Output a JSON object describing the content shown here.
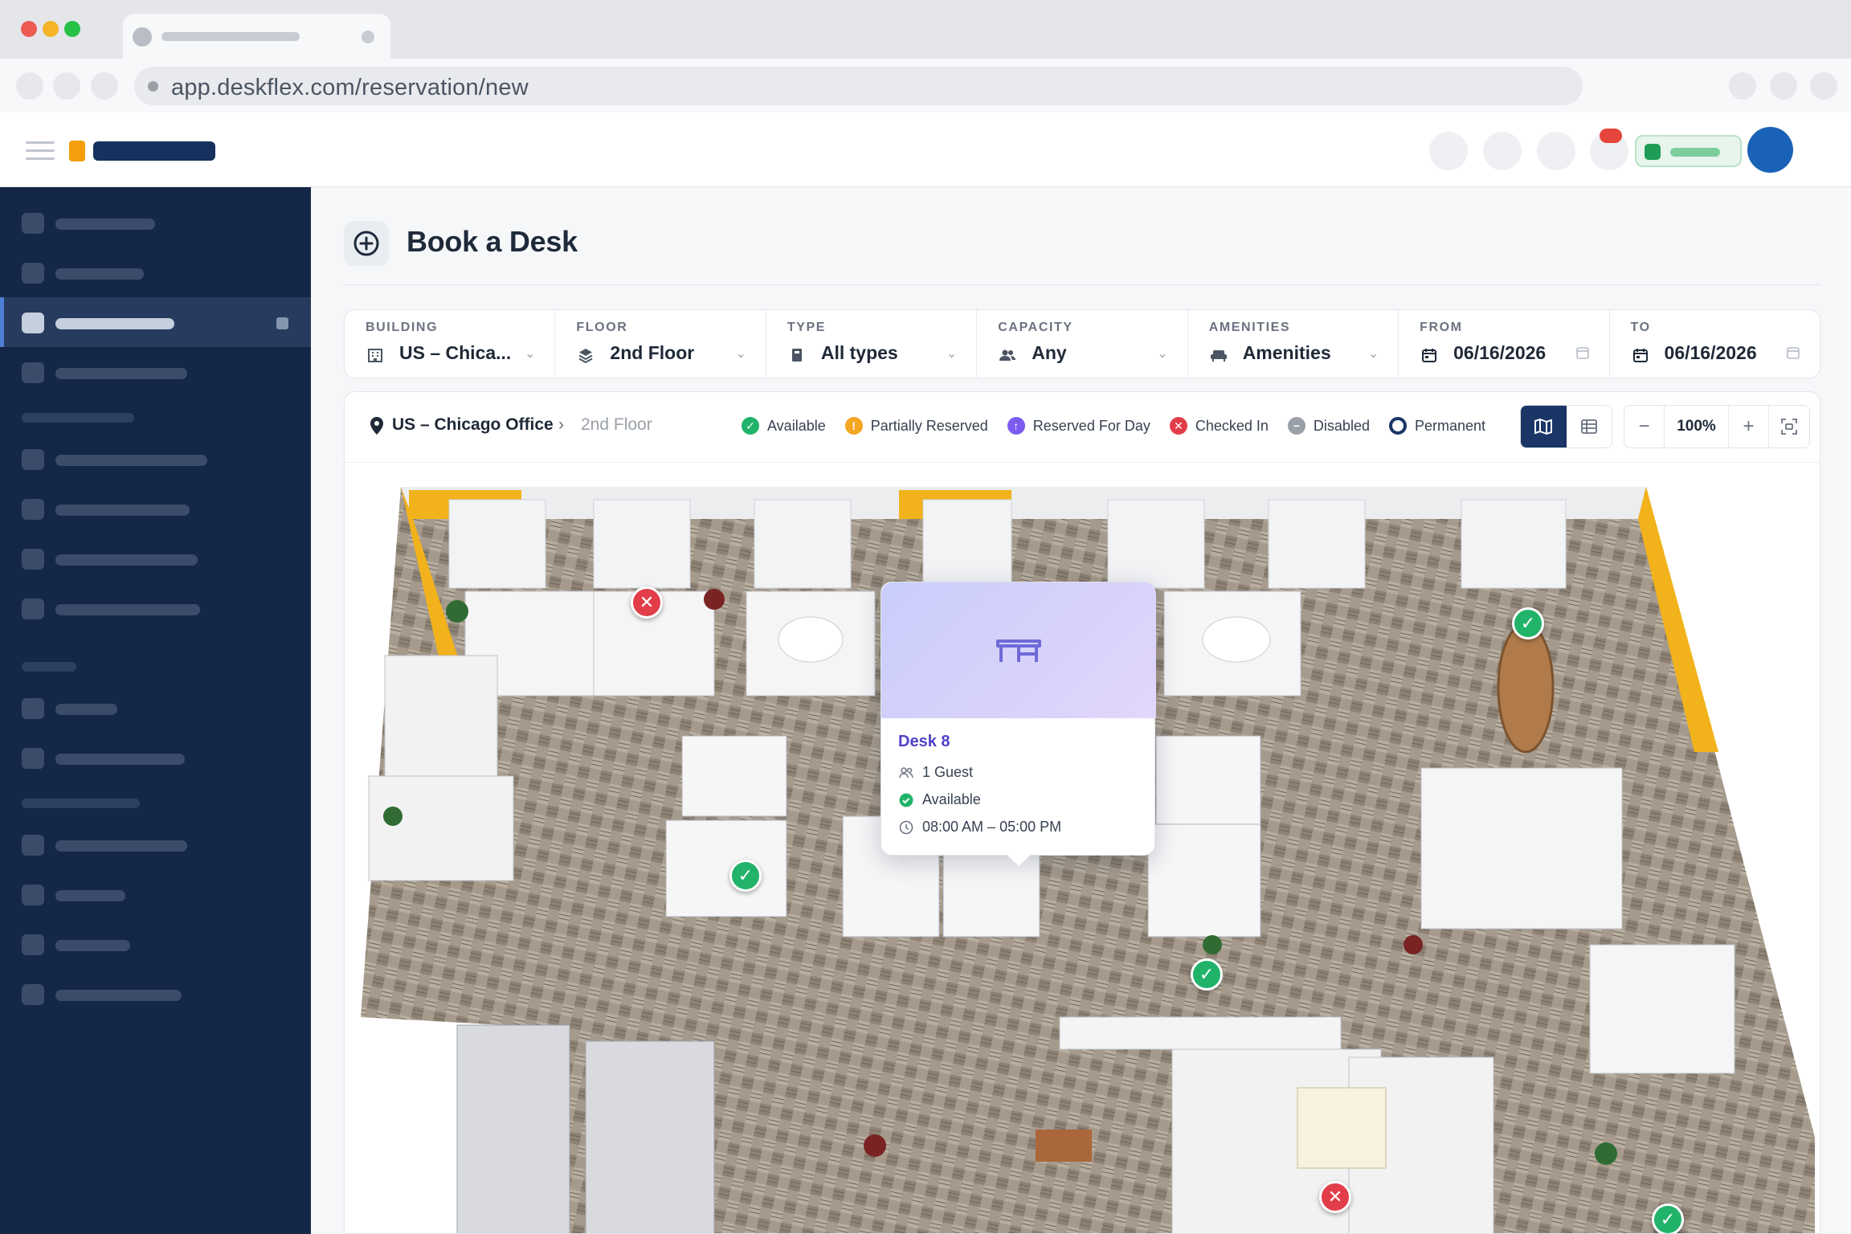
{
  "browser": {
    "url": "app.deskflex.com/reservation/new"
  },
  "page": {
    "title": "Book a Desk"
  },
  "filters": [
    {
      "label": "BUILDING",
      "value": "US – Chica...",
      "icon": "building-icon",
      "control": "chevron-down-icon"
    },
    {
      "label": "FLOOR",
      "value": "2nd Floor",
      "icon": "layers-icon",
      "control": "chevron-down-icon"
    },
    {
      "label": "TYPE",
      "value": "All types",
      "icon": "desk-type-icon",
      "control": "chevron-down-icon"
    },
    {
      "label": "CAPACITY",
      "value": "Any",
      "icon": "people-icon",
      "control": "chevron-down-icon"
    },
    {
      "label": "AMENITIES",
      "value": "Amenities",
      "icon": "sofa-icon",
      "control": "chevron-down-icon"
    },
    {
      "label": "FROM",
      "value": "06/16/2026",
      "icon": "calendar-icon",
      "control": "calendar-outline-icon"
    },
    {
      "label": "TO",
      "value": "06/16/2026",
      "icon": "calendar-icon",
      "control": "calendar-outline-icon"
    }
  ],
  "map": {
    "breadcrumb": {
      "location": "US – Chicago Office",
      "separator": "›",
      "floor": "2nd Floor"
    },
    "legend": [
      {
        "label": "Available",
        "color": "#22b36b",
        "icon": "check-circle-icon"
      },
      {
        "label": "Partially Reserved",
        "color": "#f5a623",
        "icon": "alert-circle-icon"
      },
      {
        "label": "Reserved For Day",
        "color": "#7c5cf0",
        "icon": "arrow-up-circle-icon"
      },
      {
        "label": "Checked In",
        "color": "#e23e4a",
        "icon": "x-circle-icon"
      },
      {
        "label": "Disabled",
        "color": "#9aa0a8",
        "icon": "minus-circle-icon"
      },
      {
        "label": "Permanent",
        "color": "#1a3566",
        "icon": "ring-circle-icon"
      }
    ],
    "zoom": {
      "minus": "−",
      "value": "100%",
      "plus": "+"
    }
  },
  "tooltip": {
    "desk_name": "Desk 8",
    "guests": "1 Guest",
    "status": "Available",
    "time": "08:00 AM – 05:00 PM"
  },
  "colors": {
    "sidebar": "#152746",
    "accent": "#1a3566",
    "available": "#22b36b",
    "checked_in": "#e23e4a",
    "tooltip_title": "#5040c8"
  }
}
